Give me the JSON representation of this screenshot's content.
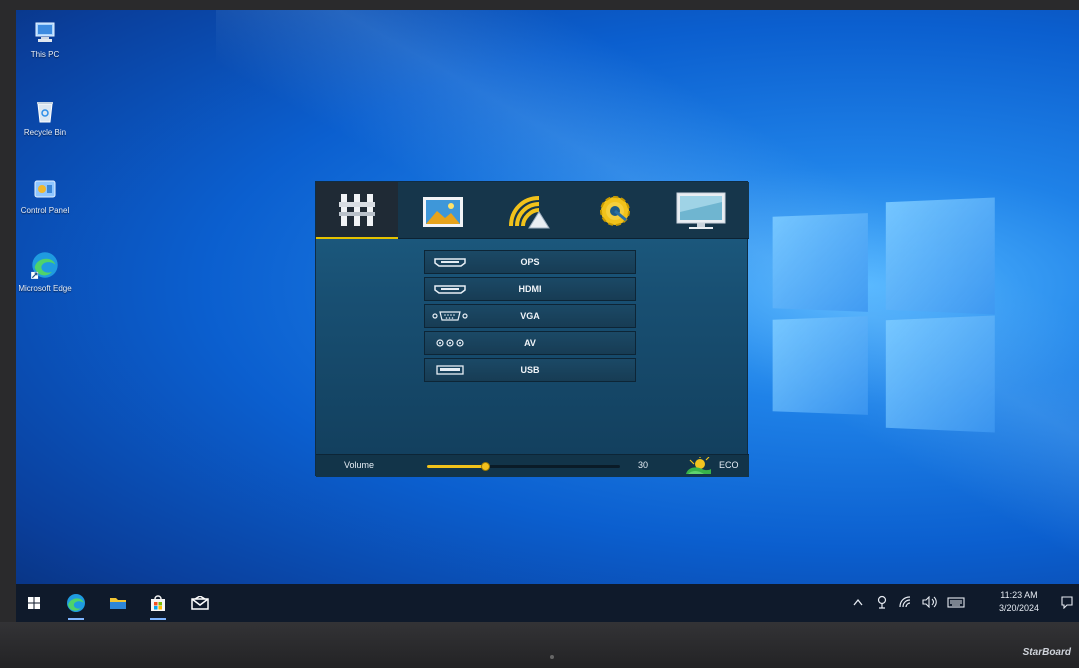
{
  "desktop": {
    "icons": [
      {
        "label": "This PC"
      },
      {
        "label": "Recycle Bin"
      },
      {
        "label": "Control Panel"
      },
      {
        "label": "Microsoft Edge"
      }
    ]
  },
  "osd": {
    "tabs": [
      {
        "icon": "input-source-icon",
        "active": true
      },
      {
        "icon": "picture-icon",
        "active": false
      },
      {
        "icon": "sound-icon",
        "active": false
      },
      {
        "icon": "settings-gear-icon",
        "active": false
      },
      {
        "icon": "display-icon",
        "active": false
      }
    ],
    "sources": [
      {
        "icon": "hdmi-port-icon",
        "label": "OPS"
      },
      {
        "icon": "hdmi-port-icon",
        "label": "HDMI"
      },
      {
        "icon": "vga-port-icon",
        "label": "VGA"
      },
      {
        "icon": "av-port-icon",
        "label": "AV"
      },
      {
        "icon": "usb-port-icon",
        "label": "USB"
      }
    ],
    "volume": {
      "label": "Volume",
      "value": "30",
      "level_fraction": 0.3
    },
    "eco": {
      "label": "ECO",
      "icon": "eco-sun-icon"
    }
  },
  "taskbar": {
    "items": [
      "start-icon",
      "edge-icon",
      "file-explorer-icon",
      "store-icon",
      "mail-icon"
    ],
    "tray": {
      "icons": [
        "chevron-up-icon",
        "network-icon",
        "wifi-icon",
        "volume-icon",
        "keyboard-icon"
      ],
      "time": "11:23 AM",
      "date": "3/20/2024"
    }
  },
  "device": {
    "brand": "StarBoard"
  },
  "colors": {
    "accent": "#e5c200",
    "osd_bg": "#184f72",
    "taskbar": "#0f1a2b"
  }
}
